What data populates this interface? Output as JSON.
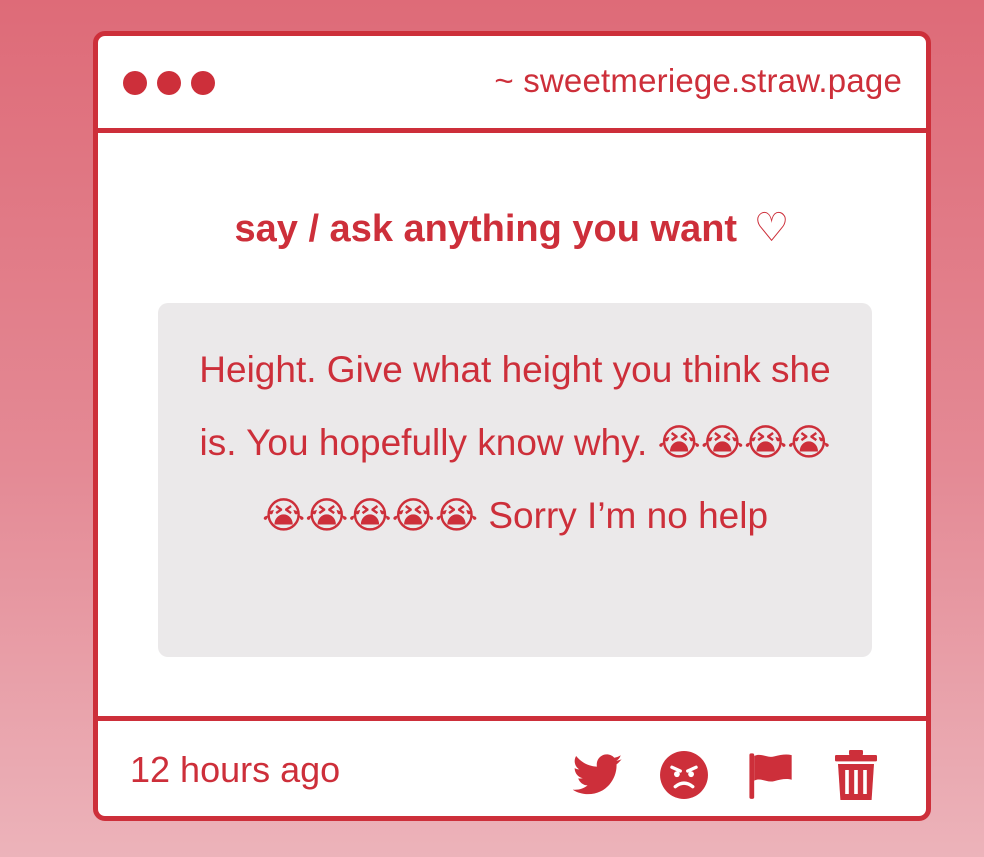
{
  "window": {
    "url": "~ sweetmeriege.straw.page"
  },
  "prompt": {
    "text": "say / ask anything you want",
    "heart": "♡"
  },
  "message": {
    "text": "Height. Give what height you think she is. You hopefully know why. 😭😭😭😭😭😭😭😭😭 Sorry I’m no help"
  },
  "footer": {
    "timestamp": "12 hours ago",
    "actions": [
      {
        "icon": "twitter-icon"
      },
      {
        "icon": "angry-face-icon"
      },
      {
        "icon": "flag-icon"
      },
      {
        "icon": "trash-icon"
      }
    ]
  },
  "colors": {
    "accent": "#cd2f3a",
    "message_bg": "#ebe9ea",
    "background_top": "#de6b78",
    "background_bottom": "#ecb3ba"
  }
}
